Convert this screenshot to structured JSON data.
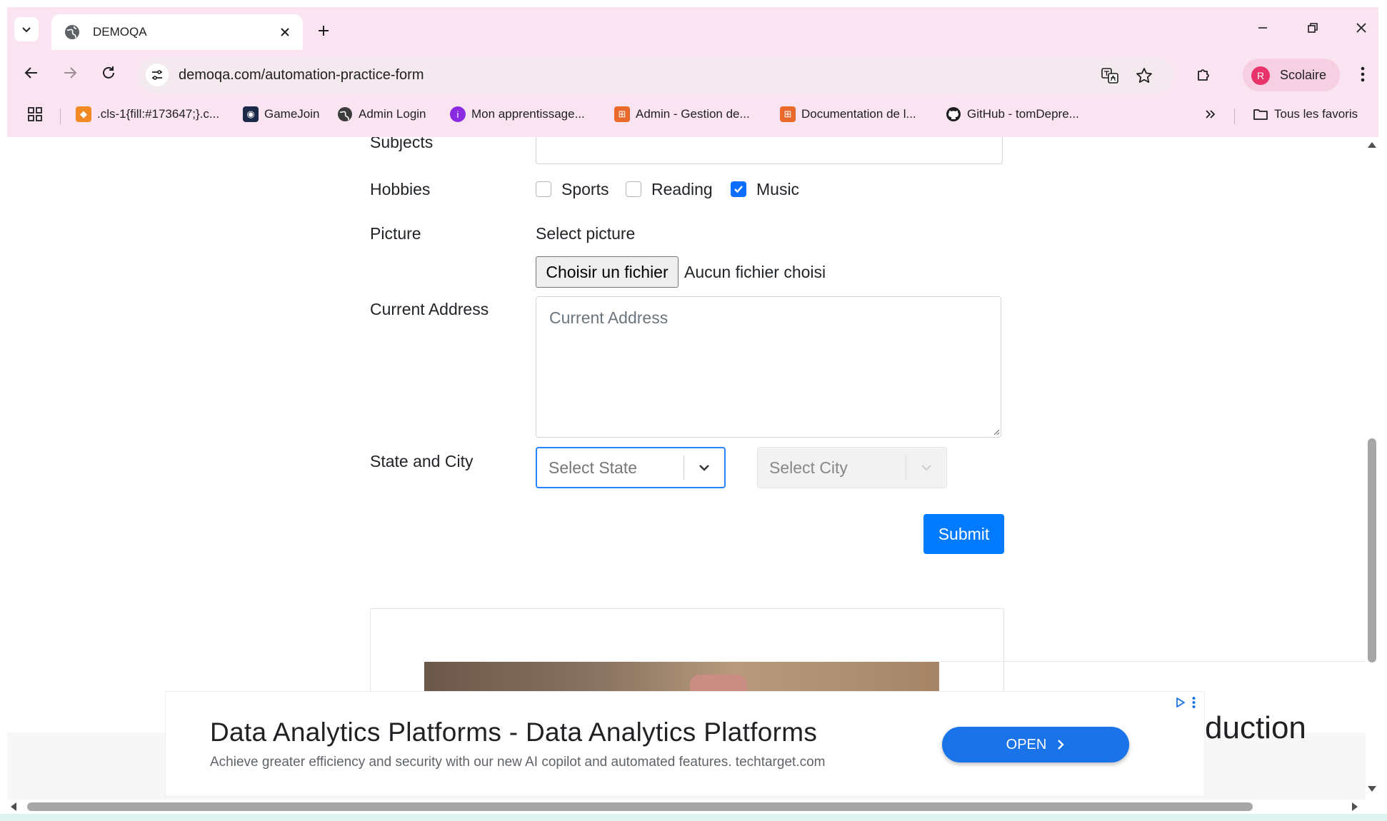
{
  "browser": {
    "tab_title": "DEMOQA",
    "url": "demoqa.com/automation-practice-form",
    "profile_initial": "R",
    "profile_name": "Scolaire",
    "bookmarks": [
      {
        "label": ".cls-1{fill:#173647;}.c..."
      },
      {
        "label": "GameJoin"
      },
      {
        "label": "Admin Login"
      },
      {
        "label": "Mon apprentissage..."
      },
      {
        "label": "Admin - Gestion de..."
      },
      {
        "label": "Documentation de l..."
      },
      {
        "label": "GitHub - tomDepre..."
      }
    ],
    "all_bookmarks_label": "Tous les favoris"
  },
  "form": {
    "subjects_label": "Subjects",
    "hobbies_label": "Hobbies",
    "hobbies": [
      {
        "label": "Sports",
        "checked": false
      },
      {
        "label": "Reading",
        "checked": false
      },
      {
        "label": "Music",
        "checked": true
      }
    ],
    "picture_label": "Picture",
    "select_picture_label": "Select picture",
    "file_button_label": "Choisir un fichier",
    "file_status": "Aucun fichier choisi",
    "current_address_label": "Current Address",
    "current_address_placeholder": "Current Address",
    "state_city_label": "State and City",
    "state_placeholder": "Select State",
    "city_placeholder": "Select City",
    "submit_label": "Submit"
  },
  "ad": {
    "title": "Data Analytics Platforms - Data Analytics Platforms",
    "description": "Achieve greater efficiency and security with our new AI copilot and automated features. techtarget.com",
    "open_label": "OPEN",
    "peek_text": "duction"
  },
  "colors": {
    "chrome_bg": "#fbe4f1",
    "accent_blue": "#007bff",
    "ad_button": "#1a73e8",
    "profile_avatar": "#e8336a"
  }
}
